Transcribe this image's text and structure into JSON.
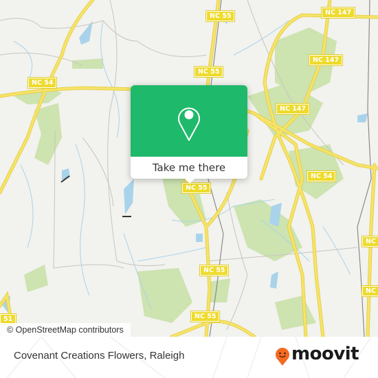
{
  "map": {
    "road_labels": [
      {
        "id": "nc55-top",
        "text": "NC 55"
      },
      {
        "id": "nc55-upper",
        "text": "NC 55"
      },
      {
        "id": "nc54-west",
        "text": "NC 54"
      },
      {
        "id": "nc147-top",
        "text": "NC 147"
      },
      {
        "id": "nc147-mid",
        "text": "NC 147"
      },
      {
        "id": "nc147-lower",
        "text": "NC 147"
      },
      {
        "id": "nc55-popup",
        "text": "NC 55"
      },
      {
        "id": "nc54-east",
        "text": "NC 54"
      },
      {
        "id": "nc-right-1",
        "text": "NC"
      },
      {
        "id": "nc55-mid",
        "text": "NC 55"
      },
      {
        "id": "nc-right-2",
        "text": "NC"
      },
      {
        "id": "nc55-bottom",
        "text": "NC 55"
      },
      {
        "id": "route-51",
        "text": "51"
      }
    ],
    "colors": {
      "background": "#f2f2ee",
      "highway": "#f7e36b",
      "water": "#a9d3ea",
      "park": "#cde3b0",
      "popup_green": "#1fb96b"
    }
  },
  "popup": {
    "icon": "map-pin-icon",
    "button_label": "Take me there"
  },
  "attribution": "© OpenStreetMap contributors",
  "footer": {
    "title": "Covenant Creations Flowers, Raleigh",
    "logo_text": "moovit",
    "logo_icon": "moovit-pin-icon",
    "logo_color": "#f26b21"
  }
}
